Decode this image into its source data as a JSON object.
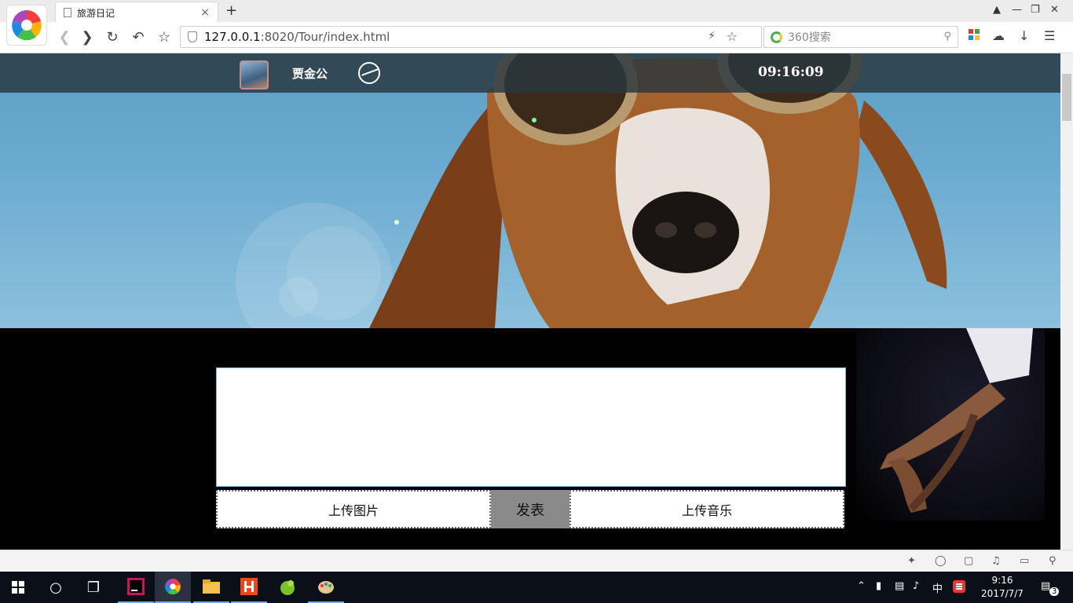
{
  "browser": {
    "tab_title": "旅游日记",
    "new_tab_label": "+",
    "tab_close": "×",
    "url_host": "127.0.0.1",
    "url_path": ":8020/Tour/index.html",
    "search_placeholder": "360搜索"
  },
  "page": {
    "username": "贾金公",
    "clock": "09:16:09",
    "textarea_value": "",
    "upload_image_label": "上传图片",
    "publish_label": "发表",
    "upload_music_label": "上传音乐"
  },
  "taskbar": {
    "time": "9:16",
    "date": "2017/7/7",
    "ime": "中",
    "notifications": "3"
  },
  "colors": {
    "nav_bg": "#28373e",
    "publish_bg": "#8a8a8a",
    "page_bg": "#000000"
  }
}
